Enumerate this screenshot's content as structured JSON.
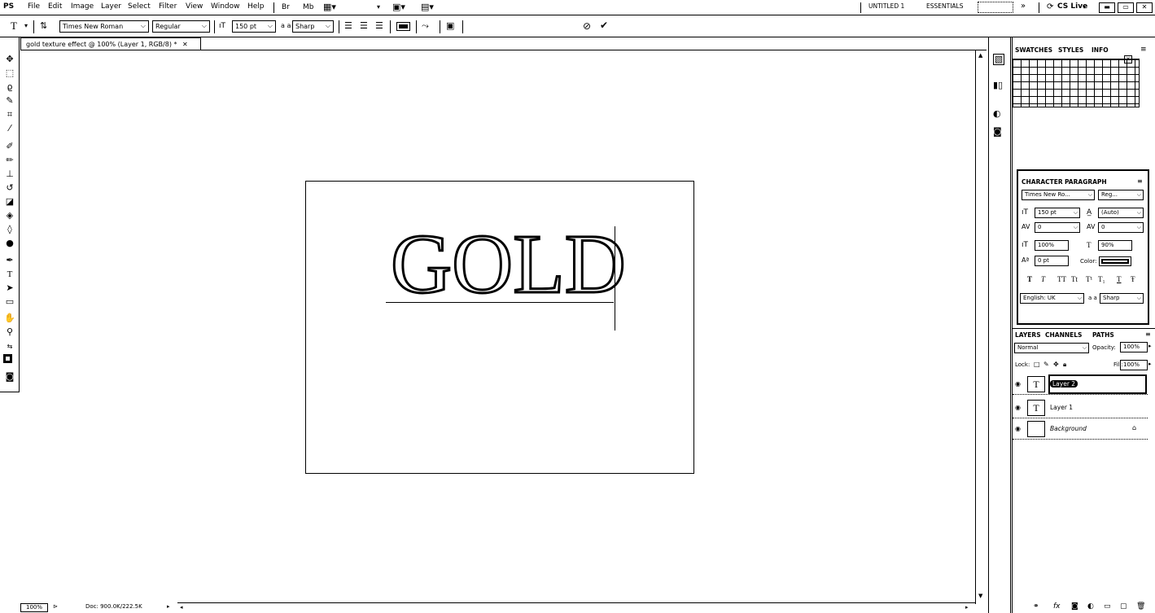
{
  "menubar": {
    "logo": "PS",
    "items": [
      "File",
      "Edit",
      "Image",
      "Layer",
      "Select",
      "Filter",
      "View",
      "Window",
      "Help"
    ],
    "workspaces": [
      "UNTITLED 1",
      "ESSENTIALS"
    ],
    "cslive": "CS Live"
  },
  "options": {
    "font_family": "Times New Roman",
    "font_style": "Regular",
    "font_size": "150 pt",
    "aa_label": "a a",
    "antialias": "Sharp"
  },
  "document": {
    "tab_title": "gold texture effect @ 100% (Layer 1, RGB/8) *",
    "canvas_text": "GOLD",
    "zoom": "100%",
    "doc_info": "Doc: 900.0K/222.5K"
  },
  "panels": {
    "swatches_tabs": [
      "SWATCHES",
      "STYLES",
      "INFO"
    ],
    "character_tabs": [
      "CHARACTER",
      "PARAGRAPH"
    ],
    "character": {
      "font_family": "Times New Ro...",
      "font_style": "Reg...",
      "size": "150 pt",
      "leading": "(Auto)",
      "kerning": "0",
      "tracking": "0",
      "vscale": "100%",
      "hscale": "90%",
      "baseline": "0 pt",
      "color_label": "Color:",
      "language": "English: UK",
      "antialias": "Sharp",
      "type_buttons": [
        "T",
        "T",
        "TT",
        "Tt",
        "T¹",
        "T₁",
        "T",
        "Ŧ"
      ]
    },
    "layers_tabs": [
      "LAYERS",
      "CHANNELS",
      "PATHS"
    ],
    "layers": {
      "blend_mode": "Normal",
      "opacity_label": "Opacity:",
      "opacity": "100%",
      "lock_label": "Lock:",
      "fill_label": "Fill:",
      "fill": "100%",
      "rows": [
        {
          "name": "Layer 2",
          "thumb": "T"
        },
        {
          "name": "Layer 1",
          "thumb": "T"
        },
        {
          "name": "Background",
          "thumb": ""
        }
      ]
    }
  }
}
